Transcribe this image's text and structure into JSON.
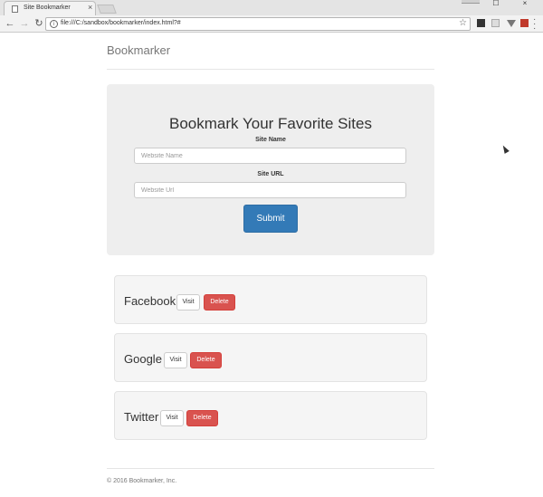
{
  "browser": {
    "tab_title": "Site Bookmarker",
    "tab_close": "×",
    "url": "file:///C:/sandbox/bookmarker/index.html?#",
    "star": "☆",
    "window_max": "☐",
    "window_close": "×"
  },
  "header": {
    "brand": "Bookmarker"
  },
  "form": {
    "title": "Bookmark Your Favorite Sites",
    "site_name_label": "Site Name",
    "site_name_placeholder": "Website Name",
    "site_url_label": "Site URL",
    "site_url_placeholder": "Website Url",
    "submit_label": "Submit"
  },
  "bookmarks": [
    {
      "name": "Facebook",
      "visit_label": "Visit",
      "delete_label": "Delete"
    },
    {
      "name": "Google",
      "visit_label": "Visit",
      "delete_label": "Delete"
    },
    {
      "name": "Twitter",
      "visit_label": "Visit",
      "delete_label": "Delete"
    }
  ],
  "footer": {
    "text": "© 2016 Bookmarker, Inc."
  },
  "colors": {
    "primary": "#337ab7",
    "danger": "#d9534f",
    "jumbotron": "#eeeeee",
    "well": "#f5f5f5"
  }
}
